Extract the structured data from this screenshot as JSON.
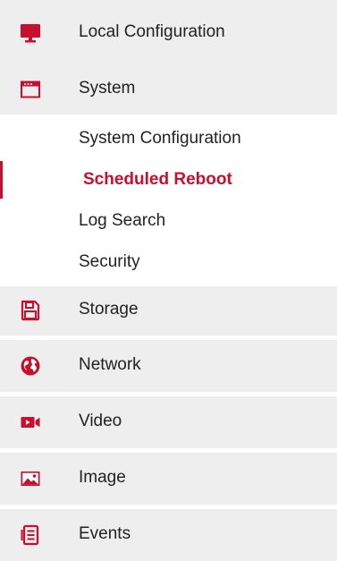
{
  "accent_color": "#c8102e",
  "menu": {
    "local_configuration": {
      "label": "Local Configuration",
      "icon": "monitor-icon"
    },
    "system": {
      "label": "System",
      "icon": "window-icon",
      "submenu": [
        {
          "label": "System Configuration"
        },
        {
          "label": "Scheduled Reboot",
          "active": true
        },
        {
          "label": "Log Search"
        },
        {
          "label": "Security"
        }
      ]
    },
    "storage": {
      "label": "Storage",
      "icon": "floppy-disk-icon"
    },
    "network": {
      "label": "Network",
      "icon": "globe-icon"
    },
    "video": {
      "label": "Video",
      "icon": "video-camera-icon"
    },
    "image": {
      "label": "Image",
      "icon": "image-icon"
    },
    "events": {
      "label": "Events",
      "icon": "events-list-icon"
    }
  }
}
